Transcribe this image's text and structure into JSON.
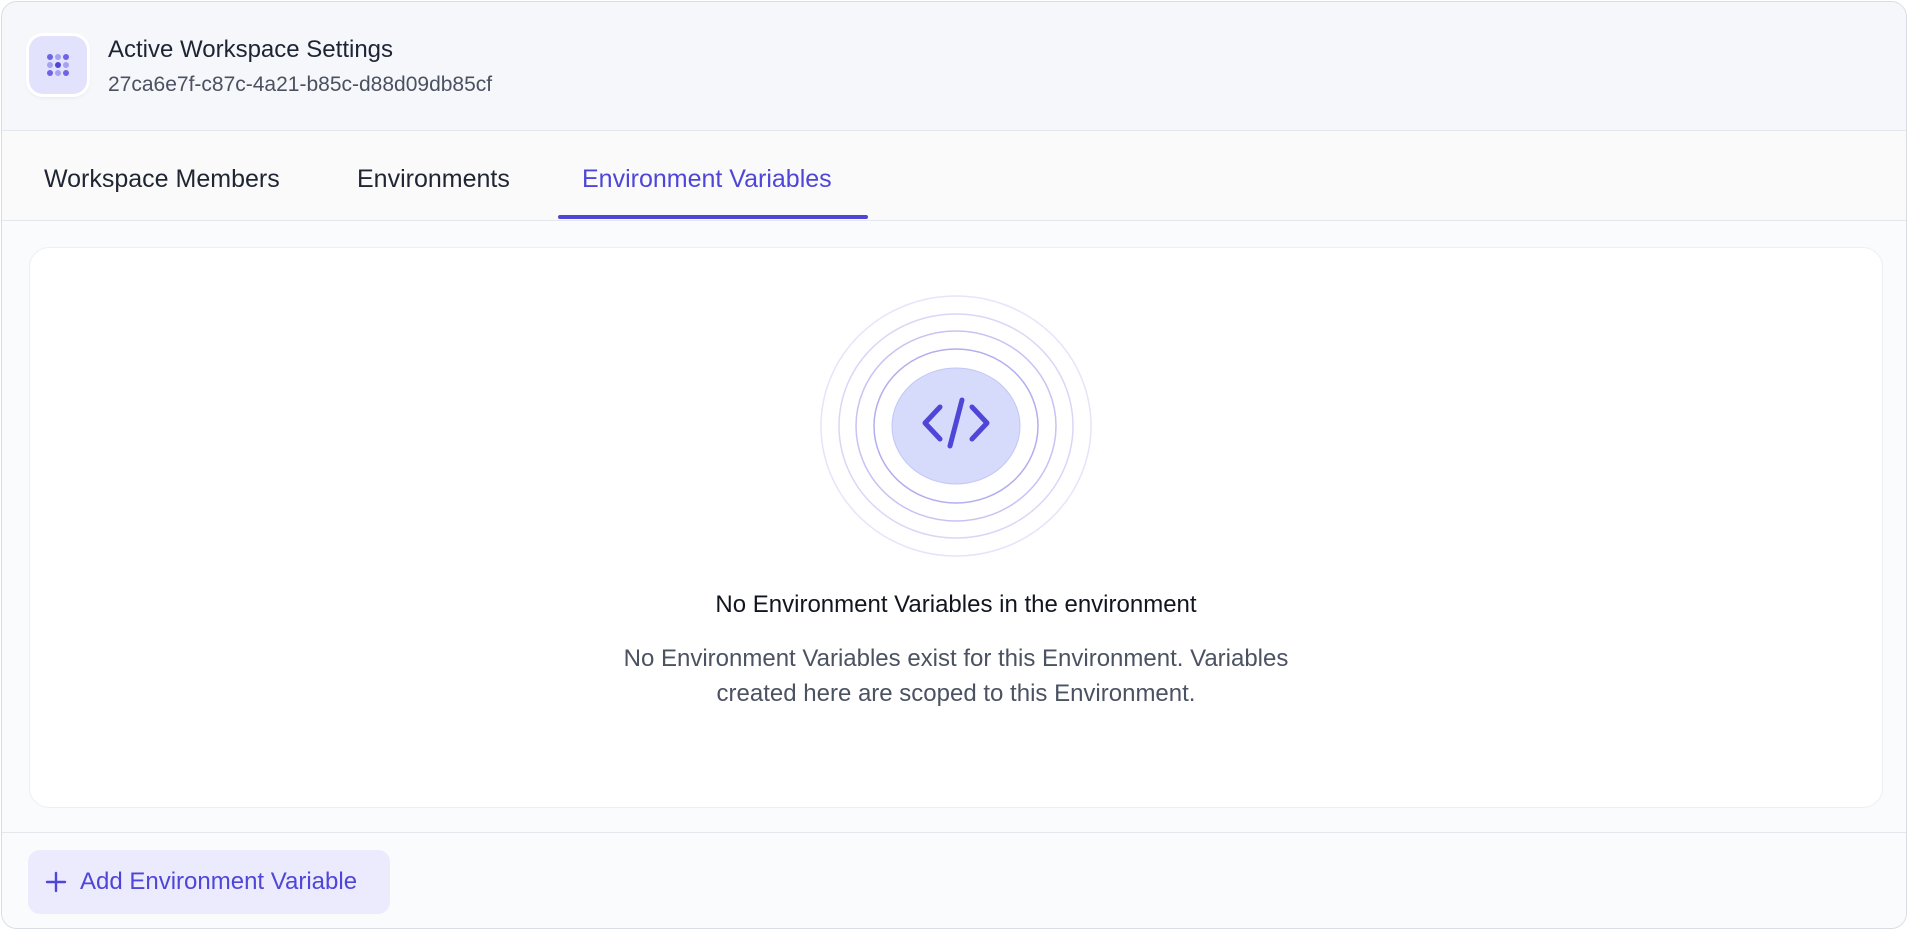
{
  "header": {
    "title": "Active Workspace Settings",
    "workspace_id": "27ca6e7f-c87c-4a21-b85c-d88d09db85cf",
    "icon": "grid-dots-icon"
  },
  "tabs": [
    {
      "label": "Workspace Members",
      "active": false
    },
    {
      "label": "Environments",
      "active": false
    },
    {
      "label": "Environment Variables",
      "active": true
    }
  ],
  "empty_state": {
    "icon": "code-icon",
    "title": "No Environment Variables in the environment",
    "description_line1": "No Environment Variables exist for this Environment. Variables",
    "description_line2": "created here are scoped to this Environment."
  },
  "footer": {
    "add_button_label": "Add Environment Variable",
    "add_button_icon": "plus-icon"
  },
  "colors": {
    "accent": "#4f46d8",
    "accent_light": "#eceafd",
    "text_primary": "#1f2532",
    "text_secondary": "#4b5262"
  }
}
